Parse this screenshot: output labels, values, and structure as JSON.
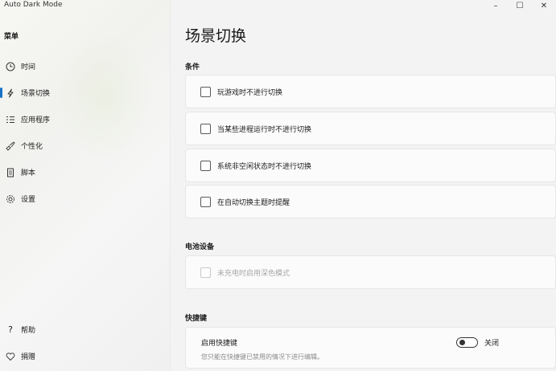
{
  "window": {
    "title": "Auto Dark Mode",
    "controls": {
      "minimize": "–",
      "maximize": "☐",
      "close": "✕"
    }
  },
  "sidebar": {
    "menu_label": "菜单",
    "items": [
      {
        "label": "时间",
        "icon": "clock-icon"
      },
      {
        "label": "场景切换",
        "icon": "lightning-icon",
        "active": true
      },
      {
        "label": "应用程序",
        "icon": "list-icon"
      },
      {
        "label": "个性化",
        "icon": "brush-icon"
      },
      {
        "label": "脚本",
        "icon": "document-icon"
      },
      {
        "label": "设置",
        "icon": "gear-icon"
      }
    ],
    "bottom_items": [
      {
        "label": "帮助",
        "icon": "question-icon"
      },
      {
        "label": "捐赠",
        "icon": "heart-icon"
      }
    ]
  },
  "main": {
    "title": "场景切换",
    "conditions": {
      "label": "条件",
      "items": [
        {
          "label": "玩游戏时不进行切换",
          "checked": false
        },
        {
          "label": "当某些进程运行时不进行切换",
          "checked": false
        },
        {
          "label": "系统非空闲状态时不进行切换",
          "checked": false
        },
        {
          "label": "在自动切换主题时提醒",
          "checked": false
        }
      ]
    },
    "battery": {
      "label": "电池设备",
      "items": [
        {
          "label": "未充电时启用深色模式",
          "checked": false,
          "disabled": true
        }
      ]
    },
    "hotkeys": {
      "label": "快捷键",
      "enable_label": "启用快捷键",
      "description": "您只能在快捷键已禁用的情况下进行编辑。",
      "toggle_state": "关闭",
      "toggle_on": false
    }
  },
  "colors": {
    "accent": "#1a73c7",
    "background": "#f3f3f3",
    "card": "#fbfbfb"
  }
}
